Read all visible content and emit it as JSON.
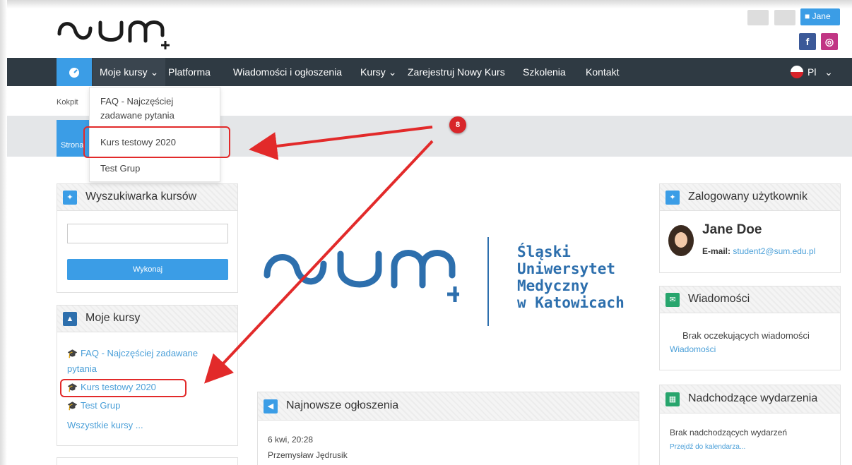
{
  "header": {
    "logo_text": "SUM+",
    "user_label": "Jane",
    "social": {
      "facebook": "f",
      "instagram": "◎"
    }
  },
  "nav": {
    "home_icon": "dashboard-icon",
    "items": [
      {
        "label": "Moje kursy",
        "caret": "⌄"
      },
      {
        "label": "Platforma"
      },
      {
        "label": "Wiadomości i ogłoszenia"
      },
      {
        "label": "Kursy",
        "caret": "⌄"
      },
      {
        "label": "Zarejestruj Nowy Kurs"
      },
      {
        "label": "Szkolenia"
      },
      {
        "label": "Kontakt"
      }
    ],
    "language": "Pl",
    "language_caret": "⌄"
  },
  "breadcrumb": "Kokpit",
  "home_tab": "Strona",
  "dropdown": {
    "items": [
      "FAQ - Najczęściej",
      "zadawane pytania",
      "Kurs testowy 2020",
      "Test Grup"
    ]
  },
  "annotation": {
    "step": "8"
  },
  "search_block": {
    "title": "Wyszukiwarka kursów",
    "button": "Wykonaj",
    "placeholder": ""
  },
  "courses_block": {
    "title": "Moje kursy",
    "items": [
      "FAQ - Najczęściej zadawane",
      "pytania",
      "Kurs testowy 2020",
      "Test Grup"
    ],
    "all_link": "Wszystkie kursy ..."
  },
  "university": {
    "lines": [
      "Śląski",
      "Uniwersytet",
      "Medyczny",
      "w Katowicach"
    ]
  },
  "news_block": {
    "title": "Najnowsze ogłoszenia",
    "date": "6 kwi, 20:28",
    "author": "Przemysław Jędrusik"
  },
  "user_block": {
    "title": "Zalogowany użytkownik",
    "name": "Jane Doe",
    "email_label": "E-mail:",
    "email": "student2@sum.edu.pl"
  },
  "messages_block": {
    "title": "Wiadomości",
    "text": "Brak oczekujących wiadomości",
    "link": "Wiadomości"
  },
  "events_block": {
    "title": "Nadchodzące wydarzenia",
    "text": "Brak nadchodzących wydarzeń",
    "link": "Przejdź do kalendarza..."
  },
  "colors": {
    "accent": "#3b9de6",
    "nav": "#2f3a43",
    "brand": "#2d6fad",
    "annotation": "#e22a2a",
    "events": "#27a56d",
    "messages": "#27a56d"
  }
}
